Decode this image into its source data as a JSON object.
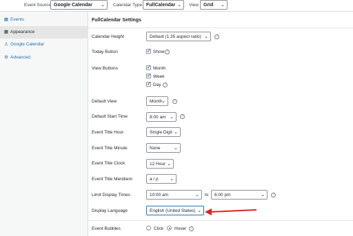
{
  "topbar": {
    "event_source_label": "Event Source",
    "event_source_value": "Google Calendar",
    "calendar_type_label": "Calendar Type",
    "calendar_type_value": "FullCalendar",
    "view_label": "View",
    "view_value": "Grid"
  },
  "sidebar": {
    "items": [
      {
        "label": "Events",
        "icon": "calendar-icon"
      },
      {
        "label": "Appearance",
        "icon": "calendar-icon"
      },
      {
        "label": "Google Calendar",
        "icon": "user-icon"
      },
      {
        "label": "Advanced",
        "icon": "gear-icon"
      }
    ]
  },
  "main": {
    "section_title": "FullCalendar Settings",
    "calendar_height": {
      "label": "Calendar Height",
      "value": "Default (1.35 aspect ratio)"
    },
    "today_button": {
      "label": "Today Button",
      "option": "Show"
    },
    "view_buttons": {
      "label": "View Buttons",
      "options": [
        "Month",
        "Week",
        "Day"
      ]
    },
    "default_view": {
      "label": "Default View",
      "value": "Month"
    },
    "default_start_time": {
      "label": "Default Start Time",
      "value": "8:00 am"
    },
    "event_title_hour": {
      "label": "Event Title Hour",
      "value": "Single Digit"
    },
    "event_title_minute": {
      "label": "Event Title Minute",
      "value": "None"
    },
    "event_title_clock": {
      "label": "Event Title Clock",
      "value": "12 Hour"
    },
    "event_title_meridiem": {
      "label": "Event Title Meridiem",
      "value": "a / p"
    },
    "limit_display_times": {
      "label": "Limit Display Times",
      "from": "10:00 am",
      "to_label": "to",
      "to": "6:00 pm"
    },
    "display_language": {
      "label": "Display Language",
      "value": "English (United States)"
    },
    "event_bubbles": {
      "label": "Event Bubbles",
      "options": [
        "Click",
        "Hover"
      ],
      "selected": "Hover"
    }
  },
  "colors": {
    "accent": "#2271b1",
    "annotation_arrow": "#e02020"
  }
}
